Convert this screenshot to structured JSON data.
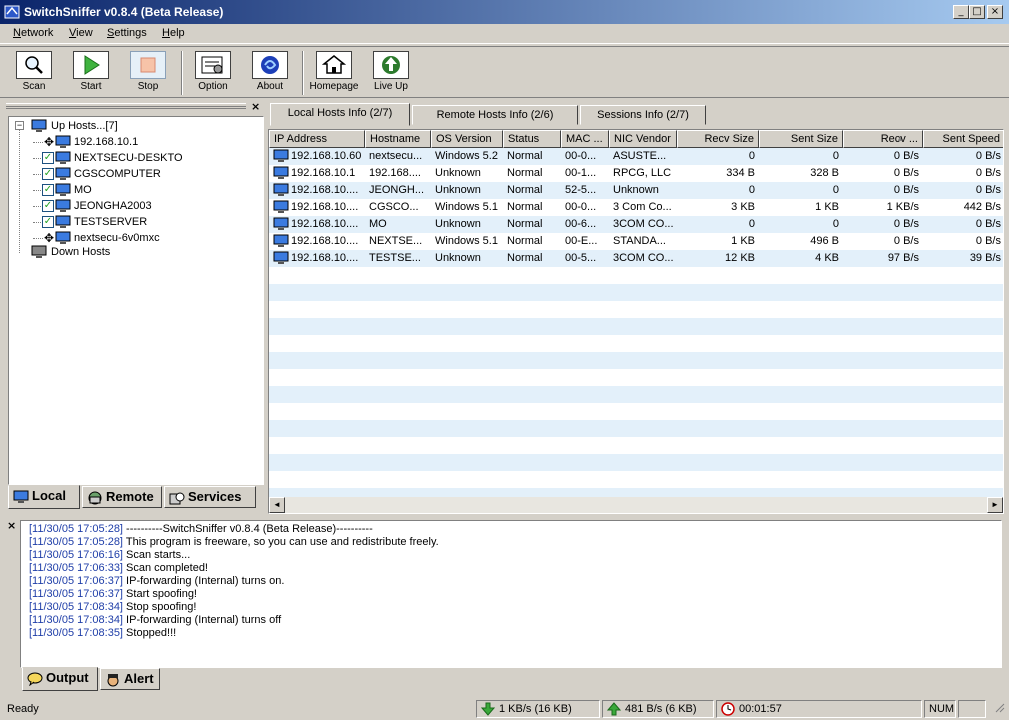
{
  "window": {
    "title": "SwitchSniffer v0.8.4 (Beta Release)",
    "minimize": "_",
    "maximize": "□",
    "close": "×"
  },
  "menu": [
    "Network",
    "View",
    "Settings",
    "Help"
  ],
  "toolbar": {
    "scan": "Scan",
    "start": "Start",
    "stop": "Stop",
    "option": "Option",
    "about": "About",
    "homepage": "Homepage",
    "liveup": "Live Up"
  },
  "tree": {
    "up_hosts": "Up Hosts...[7]",
    "hosts": [
      "192.168.10.1",
      "NEXTSECU-DESKTO",
      "CGSCOMPUTER",
      "MO",
      "JEONGHA2003",
      "TESTSERVER",
      "nextsecu-6v0mxc"
    ],
    "down_hosts": "Down Hosts",
    "expander_open": "−",
    "check_mark": "✓",
    "move_glyph": "✥"
  },
  "left_tabs": {
    "local": "Local",
    "remote": "Remote",
    "services": "Services"
  },
  "tabs": [
    "Local Hosts Info (2/7)",
    "Remote Hosts Info (2/6)",
    "Sessions Info (2/7)"
  ],
  "grid": {
    "columns": [
      "IP Address",
      "Hostname",
      "OS Version",
      "Status",
      "MAC ...",
      "NIC Vendor",
      "Recv Size",
      "Sent Size",
      "Recv ...",
      "Sent Speed"
    ],
    "sort_glyph": "▲",
    "rows": [
      [
        "192.168.10.60",
        "nextsecu...",
        "Windows 5.2",
        "Normal",
        "00-0...",
        "ASUSTE...",
        "0",
        "0",
        "0 B/s",
        "0 B/s"
      ],
      [
        "192.168.10.1",
        "192.168....",
        "Unknown",
        "Normal",
        "00-1...",
        "RPCG, LLC",
        "334 B",
        "328 B",
        "0 B/s",
        "0 B/s"
      ],
      [
        "192.168.10....",
        "JEONGH...",
        "Unknown",
        "Normal",
        "52-5...",
        "Unknown",
        "0",
        "0",
        "0 B/s",
        "0 B/s"
      ],
      [
        "192.168.10....",
        "CGSCO...",
        "Windows 5.1",
        "Normal",
        "00-0...",
        "3 Com Co...",
        "3 KB",
        "1 KB",
        "1 KB/s",
        "442 B/s"
      ],
      [
        "192.168.10....",
        "MO",
        "Unknown",
        "Normal",
        "00-6...",
        "3COM CO...",
        "0",
        "0",
        "0 B/s",
        "0 B/s"
      ],
      [
        "192.168.10....",
        "NEXTSE...",
        "Windows 5.1",
        "Normal",
        "00-E...",
        "STANDA...",
        "1 KB",
        "496 B",
        "0 B/s",
        "0 B/s"
      ],
      [
        "192.168.10....",
        "TESTSE...",
        "Unknown",
        "Normal",
        "00-5...",
        "3COM CO...",
        "12 KB",
        "4 KB",
        "97 B/s",
        "39 B/s"
      ]
    ],
    "scroll_left": "◄",
    "scroll_right": "►"
  },
  "log": [
    {
      "time": "[11/30/05 17:05:28]",
      "msg": " ----------SwitchSniffer v0.8.4 (Beta Release)----------"
    },
    {
      "time": "[11/30/05 17:05:28]",
      "msg": " This program is freeware, so you can use and redistribute freely."
    },
    {
      "time": "[11/30/05 17:06:16]",
      "msg": " Scan starts..."
    },
    {
      "time": "[11/30/05 17:06:33]",
      "msg": " Scan completed!"
    },
    {
      "time": "[11/30/05 17:06:37]",
      "msg": " IP-forwarding (Internal) turns on."
    },
    {
      "time": "[11/30/05 17:06:37]",
      "msg": " Start spoofing!"
    },
    {
      "time": "[11/30/05 17:08:34]",
      "msg": " Stop spoofing!"
    },
    {
      "time": "[11/30/05 17:08:34]",
      "msg": " IP-forwarding (Internal) turns off"
    },
    {
      "time": "[11/30/05 17:08:35]",
      "msg": " Stopped!!!"
    }
  ],
  "output_tabs": {
    "output": "Output",
    "alert": "Alert"
  },
  "panel_close": "×",
  "status": {
    "ready": "Ready",
    "down_rate": "1 KB/s (16 KB)",
    "up_rate": "481 B/s (6 KB)",
    "elapsed": "00:01:57",
    "num": "NUM"
  }
}
